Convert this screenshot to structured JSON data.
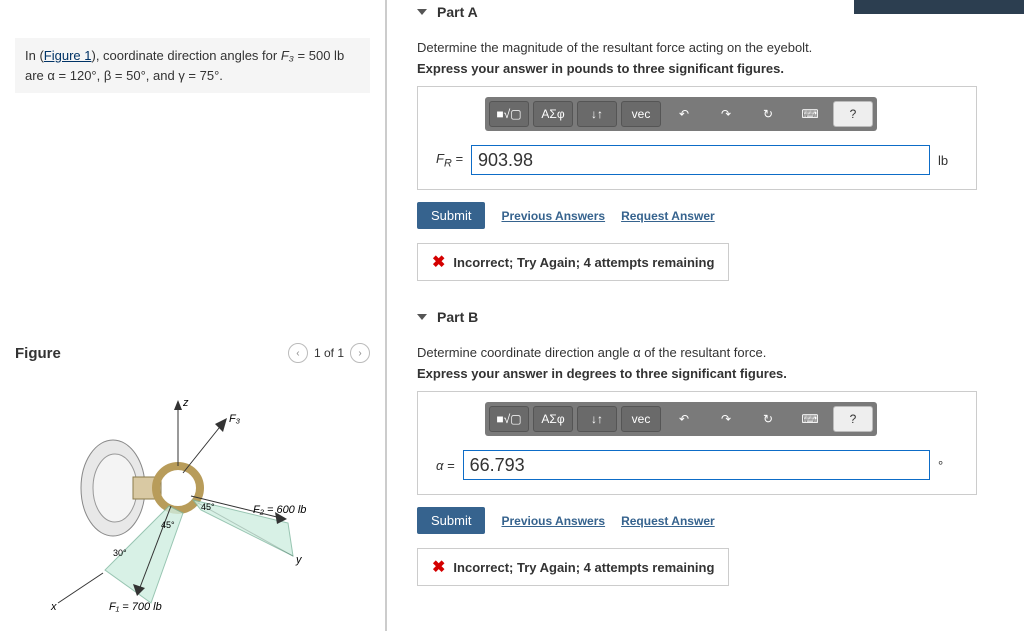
{
  "problem_statement": {
    "intro_prefix": "In (",
    "figure_link_text": "Figure 1",
    "intro_suffix": "), coordinate direction angles for ",
    "f3_label": "F₃",
    "f3_equals": " = 500 lb",
    "angles_line": "are α = 120°, β = 50°, and γ = 75°."
  },
  "figure_panel": {
    "title": "Figure",
    "pager_label": "1 of 1"
  },
  "figure_labels": {
    "z": "z",
    "y": "y",
    "x": "x",
    "f3": "F₃",
    "f2": "F₂ = 600 lb",
    "f1": "F₁ = 700 lb",
    "ang45_1": "45°",
    "ang45_2": "45°",
    "ang30": "30°"
  },
  "toolbar": {
    "templ": "■√▢",
    "greek": "ΑΣφ",
    "updown": "↓↑",
    "vec": "vec",
    "undo": "↶",
    "redo": "↷",
    "reset": "↻",
    "keyboard": "⌨",
    "help": "?"
  },
  "common": {
    "submit": "Submit",
    "prev_answers": "Previous Answers",
    "request_answer": "Request Answer",
    "feedback": "Incorrect; Try Again; 4 attempts remaining"
  },
  "partA": {
    "title": "Part A",
    "prompt1": "Determine the magnitude of the resultant force acting on the eyebolt.",
    "prompt2": "Express your answer in pounds to three significant figures.",
    "var_label": "Fʀ =",
    "value": "903.98",
    "unit": "lb"
  },
  "partB": {
    "title": "Part B",
    "prompt1": "Determine coordinate direction angle α of the resultant force.",
    "prompt2": "Express your answer in degrees to three significant figures.",
    "var_label": "α =",
    "value": "66.793",
    "unit": "°"
  }
}
